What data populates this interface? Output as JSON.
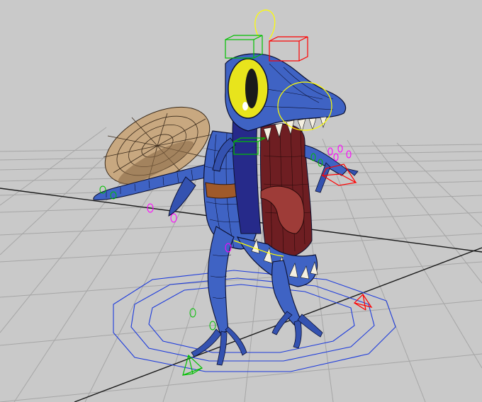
{
  "viewport": {
    "shading": "wireframe-on-shaded",
    "background_color": "#c9c9c9",
    "grid": "on"
  },
  "character": {
    "body_color": "#3f63c4",
    "belly_color": "#262a8a",
    "mouth_color": "#6e1e22",
    "eye_color": "#e8e41c",
    "shield_color": "#c8a880",
    "strap_color": "#a05a2a"
  },
  "rig": {
    "controls_colors": [
      "#ffff00",
      "#00c000",
      "#ff0000",
      "#ff00ff",
      "#1e3cdc"
    ],
    "root_control": "circle-control-icon"
  }
}
